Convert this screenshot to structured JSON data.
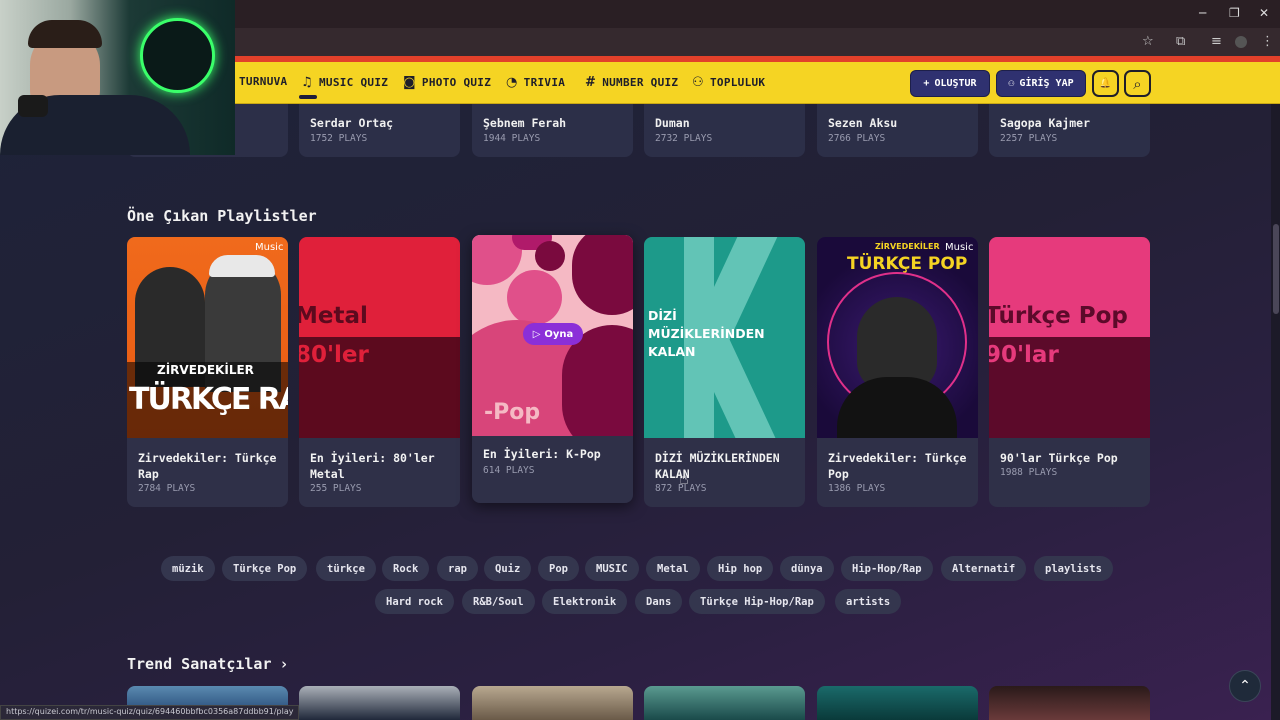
{
  "browser": {
    "controls": {
      "minimize": "─",
      "restore": "❐",
      "close": "✕"
    },
    "toolbar_icons": [
      "star-icon",
      "extension-icon",
      "media-icon",
      "profile-icon",
      "menu-icon"
    ],
    "status_url": "https://quizei.com/tr/music-quiz/quiz/694460bbfbc0356a87ddbb91/play"
  },
  "nav": {
    "items": [
      {
        "label": "TURNUVA",
        "icon": ""
      },
      {
        "label": "MUSIC QUIZ",
        "icon": "♫"
      },
      {
        "label": "PHOTO QUIZ",
        "icon": "◙"
      },
      {
        "label": "TRIVIA",
        "icon": "◔"
      },
      {
        "label": "NUMBER QUIZ",
        "icon": "#"
      },
      {
        "label": "TOPLULUK",
        "icon": "⚇"
      }
    ],
    "create_label": "OLUŞTUR",
    "create_icon": "+",
    "login_label": "GİRİŞ YAP",
    "login_icon": "⚇",
    "bell_icon": "🔔",
    "search_icon": "⌕",
    "accent": "#f5d423"
  },
  "top_artists": [
    {
      "name": "Serdar Ortaç",
      "plays": "1752 PLAYS"
    },
    {
      "name": "Şebnem Ferah",
      "plays": "1944 PLAYS"
    },
    {
      "name": "Duman",
      "plays": "2732 PLAYS"
    },
    {
      "name": "Sezen Aksu",
      "plays": "2766 PLAYS"
    },
    {
      "name": "Sagopa Kajmer",
      "plays": "2257 PLAYS"
    }
  ],
  "featured": {
    "title": "Öne Çıkan Playlistler",
    "play_label": "Oyna",
    "cards": [
      {
        "title": "Zirvedekiler: Türkçe Rap",
        "plays": "2784 PLAYS",
        "cover_line1": "ZİRVEDEKİLER",
        "cover_line2": "TÜRKÇE RAP",
        "badge": "Music"
      },
      {
        "title": "En İyileri: 80'ler Metal",
        "plays": "255 PLAYS",
        "cover_line1": "Metal",
        "cover_line2": "80'ler"
      },
      {
        "title": "En İyileri: K-Pop",
        "plays": "614 PLAYS",
        "cover_line1": "-Pop"
      },
      {
        "title": "DİZİ MÜZİKLERİNDEN KALAN",
        "plays": "872 PLAYS",
        "cover_line1": "DİZİ MÜZİKLERİNDEN KALAN"
      },
      {
        "title": "Zirvedekiler: Türkçe Pop",
        "plays": "1386 PLAYS",
        "cover_line1": "ZİRVEDEKİLER",
        "cover_line2": "TÜRKÇE POP",
        "badge": "Music"
      },
      {
        "title": "90'lar Türkçe Pop",
        "plays": "1988 PLAYS",
        "cover_line1": "Türkçe Pop",
        "cover_line2": "90'lar"
      }
    ]
  },
  "tags_row1": [
    "müzik",
    "Türkçe Pop",
    "türkçe",
    "Rock",
    "rap",
    "Quiz",
    "Pop",
    "MUSIC",
    "Metal",
    "Hip hop",
    "dünya",
    "Hip-Hop/Rap",
    "Alternatif",
    "playlists"
  ],
  "tags_row2": [
    "Hard rock",
    "R&B/Soul",
    "Elektronik",
    "Dans",
    "Türkçe Hip-Hop/Rap",
    "artists"
  ],
  "trending": {
    "title": "Trend Sanatçılar",
    "arrow": "›"
  },
  "to_top_icon": "⌃"
}
